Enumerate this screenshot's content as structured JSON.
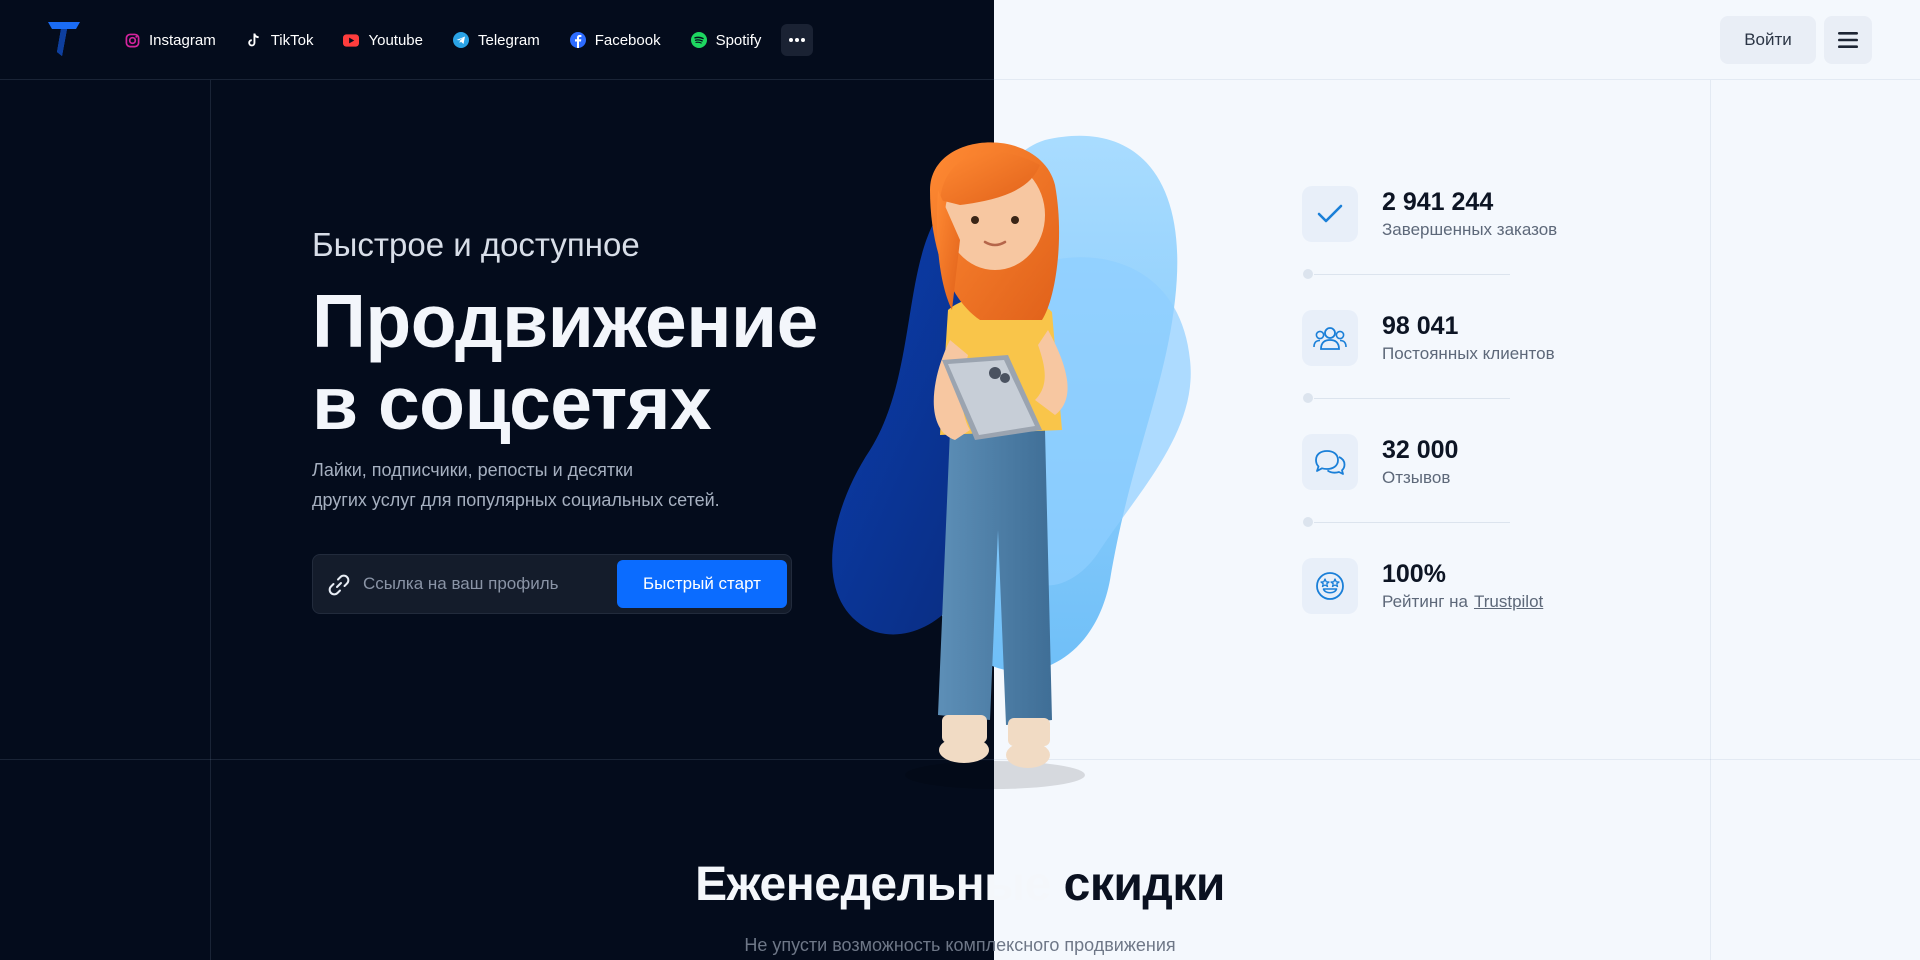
{
  "header": {
    "social_links": [
      {
        "label": "Instagram",
        "icon": "instagram-icon",
        "color": "#d6249f"
      },
      {
        "label": "TikTok",
        "icon": "tiktok-icon",
        "color": "#ffffff"
      },
      {
        "label": "Youtube",
        "icon": "youtube-icon",
        "color": "#ff3d3d"
      },
      {
        "label": "Telegram",
        "icon": "telegram-icon",
        "color": "#2aa3e6"
      },
      {
        "label": "Facebook",
        "icon": "facebook-icon",
        "color": "#2d6cff"
      },
      {
        "label": "Spotify",
        "icon": "spotify-icon",
        "color": "#1ed760"
      }
    ],
    "more_label": "•••",
    "login_label": "Войти"
  },
  "hero": {
    "kicker": "Быстрое и доступное",
    "title_line1": "Продвижение",
    "title_line2": "в соцсетях",
    "description_line1": "Лайки, подписчики, репосты и десятки",
    "description_line2": "других услуг для популярных социальных сетей.",
    "input_placeholder": "Ссылка на ваш профиль",
    "cta_label": "Быстрый старт"
  },
  "stats": [
    {
      "value": "2 941 244",
      "label": "Завершенных заказов",
      "icon": "checkmark-icon"
    },
    {
      "value": "98 041",
      "label": "Постоянных клиентов",
      "icon": "users-icon"
    },
    {
      "value": "32 000",
      "label": "Отзывов",
      "icon": "chat-bubbles-icon"
    },
    {
      "value": "100%",
      "label": "Рейтинг на",
      "link": "Trustpilot",
      "icon": "star-struck-face-icon"
    }
  ],
  "section": {
    "title_light": "Еженедельные",
    "title_dark": "скидки",
    "subtitle": "Не упусти возможность комплексного продвижения"
  },
  "colors": {
    "dark_background": "#040c1c",
    "light_background": "#f4f8fd",
    "accent": "#0b6cff",
    "stat_icon_blue": "#1a7fd8"
  }
}
